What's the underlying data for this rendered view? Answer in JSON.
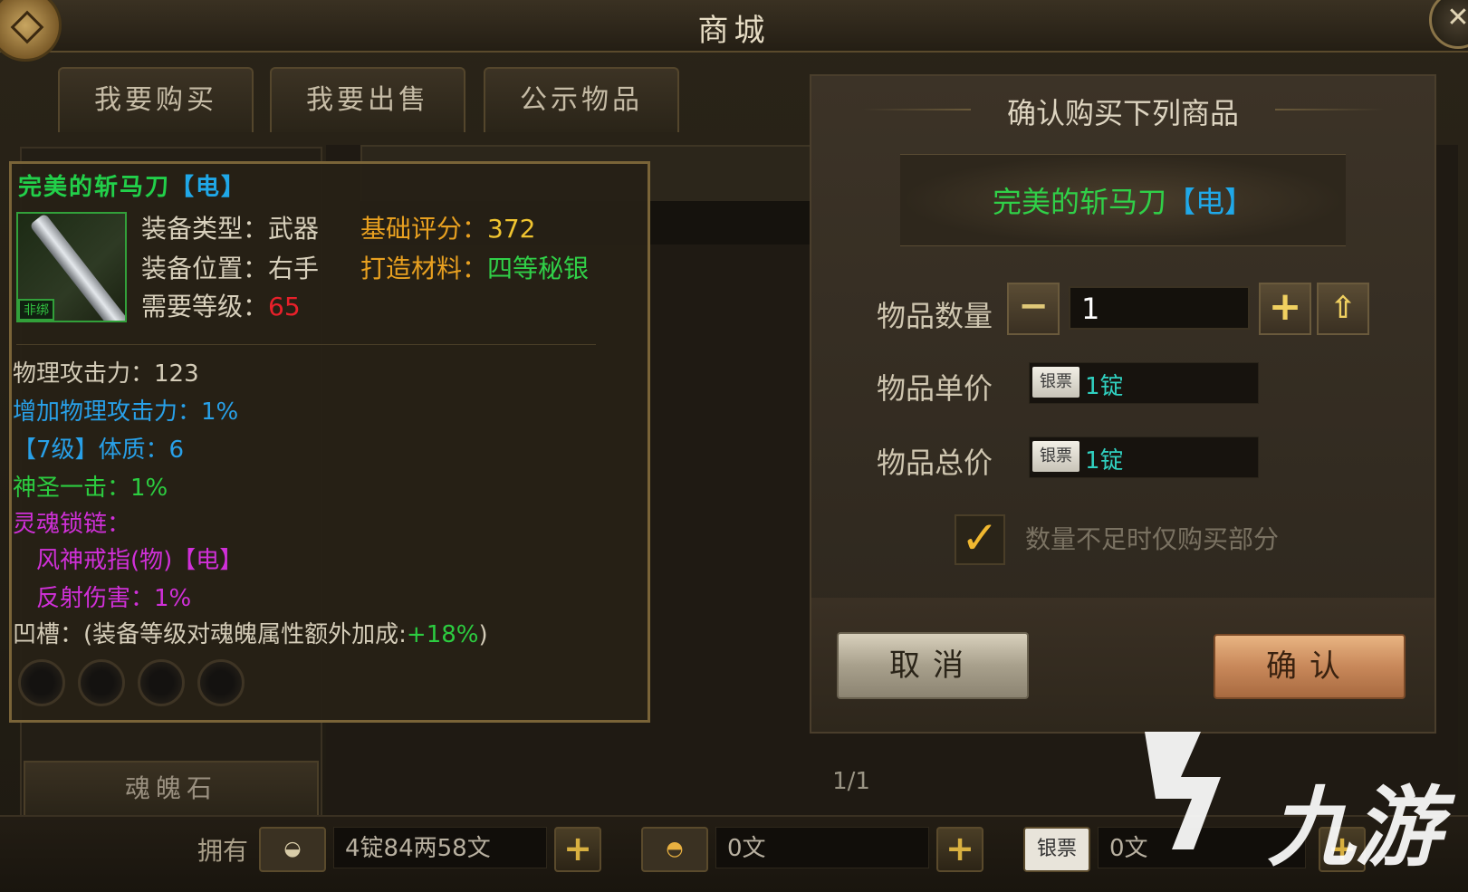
{
  "window": {
    "title": "商城",
    "close_icon": "close-icon"
  },
  "tabs": [
    {
      "label": "我要购买"
    },
    {
      "label": "我要出售"
    },
    {
      "label": "公示物品"
    }
  ],
  "category": {
    "bottom_label": "魂魄石"
  },
  "list": {
    "page_indicator": "1/1"
  },
  "tooltip": {
    "item_name": "完美的斩马刀",
    "item_element": "【电】",
    "bind_tag": "非绑",
    "equip_type_label": "装备类型：",
    "equip_type_value": "武器",
    "equip_slot_label": "装备位置：",
    "equip_slot_value": "右手",
    "level_req_label": "需要等级：",
    "level_req_value": "65",
    "base_score_label": "基础评分：",
    "base_score_value": "372",
    "material_label": "打造材料：",
    "material_value": "四等秘银",
    "stats": [
      "物理攻击力：123",
      "增加物理攻击力：1%",
      "【7级】体质：6",
      "神圣一击：1%",
      "灵魂锁链：",
      "风神戒指(物)【电】",
      "反射伤害：1%"
    ],
    "socket_prefix": "凹槽：(装备等级对魂魄属性额外加成:",
    "socket_bonus": "+18%",
    "socket_suffix": ")"
  },
  "dialog": {
    "title": "确认购买下列商品",
    "item_name": "完美的斩马刀",
    "item_element": "【电】",
    "quantity_label": "物品数量",
    "quantity_value": "1",
    "unit_price_label": "物品单价",
    "unit_price_value": "1锭",
    "total_price_label": "物品总价",
    "total_price_value": "1锭",
    "currency_note_label": "银票",
    "partial_buy_label": "数量不足时仅购买部分",
    "partial_buy_checked": true,
    "cancel_label": "取消",
    "confirm_label": "确认"
  },
  "bottom_bar": {
    "own_label": "拥有",
    "silver_value": "4锭84两58文",
    "gold_value": "0文",
    "note_label": "银票",
    "note_value": "0文"
  },
  "watermark": {
    "text": "九游"
  },
  "colors": {
    "green_name": "#30d048",
    "element_blue": "#20a8e8",
    "level_red": "#e8202a",
    "score_yellow": "#f0c430",
    "label_orange": "#e8a020"
  }
}
